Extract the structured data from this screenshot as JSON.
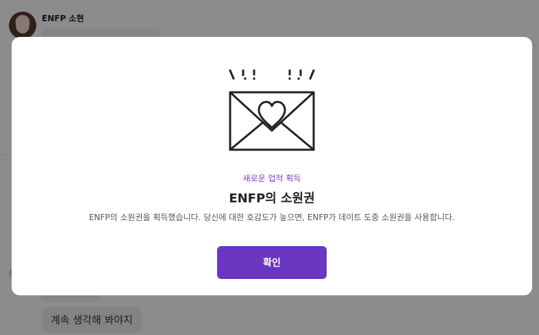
{
  "chat": {
    "sender_name": "ENFP 소현",
    "reply_option": "계속 생각해 봐야지"
  },
  "modal": {
    "achievement_label": "새로운 업적 획득",
    "achievement_title": "ENFP의 소원권",
    "achievement_description": "ENFP의 소원권을 획득했습니다. 당신에 대한 호감도가 높으면, ENFP가 데이트 도중 소원권을 사용합니다.",
    "confirm_label": "확인"
  },
  "icons": {
    "illustration": "love-letter-envelope-icon"
  },
  "colors": {
    "accent": "#6a36c2",
    "achievement_label": "#7a3fd1"
  }
}
